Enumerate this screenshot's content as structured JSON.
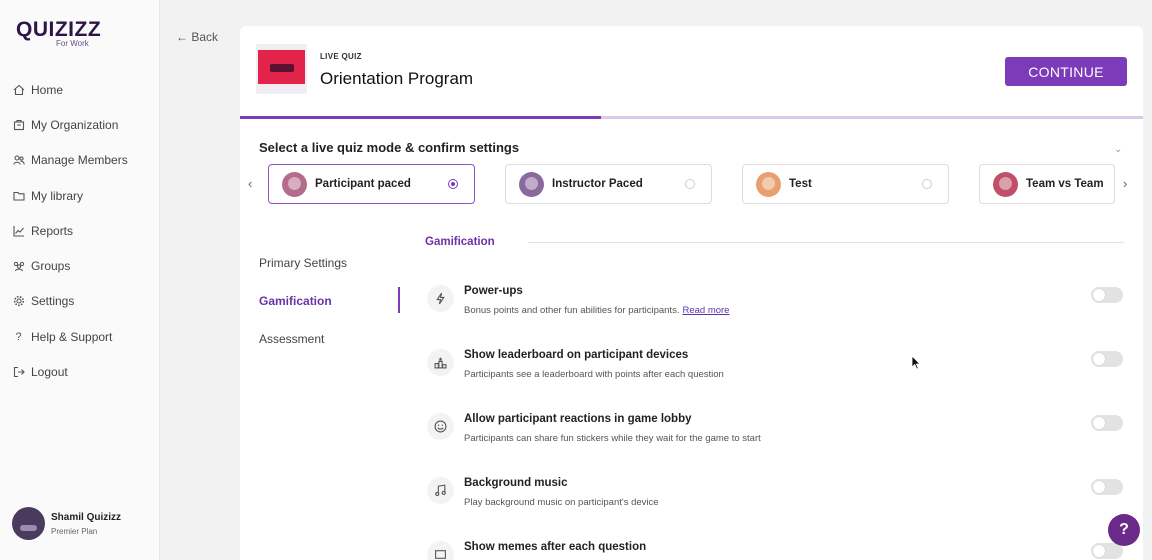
{
  "brand": {
    "logo_text": "QUIZIZZ",
    "sub_text": "For Work",
    "accent": "#7c3bb8"
  },
  "sidebar": {
    "items": [
      {
        "label": "Home",
        "icon": "home-icon"
      },
      {
        "label": "My Organization",
        "icon": "building-icon"
      },
      {
        "label": "Manage Members",
        "icon": "users-icon"
      },
      {
        "label": "My library",
        "icon": "folder-icon"
      },
      {
        "label": "Reports",
        "icon": "chart-icon"
      },
      {
        "label": "Groups",
        "icon": "group-icon"
      },
      {
        "label": "Settings",
        "icon": "gear-icon"
      },
      {
        "label": "Help & Support",
        "icon": "question-icon"
      },
      {
        "label": "Logout",
        "icon": "logout-icon"
      }
    ],
    "profile": {
      "name": "Shamil Quizizz",
      "plan": "Premier Plan"
    }
  },
  "nav": {
    "back_label": "← Back"
  },
  "quiz": {
    "type_label": "LIVE QUIZ",
    "title": "Orientation Program",
    "continue_label": "CONTINUE",
    "progress_fraction": 0.4
  },
  "modes": {
    "heading": "Select a live quiz mode & confirm settings",
    "collapse_icon": "chevron-down-icon",
    "items": [
      {
        "label": "Participant paced",
        "selected": true,
        "avatar_color": "#b56b8e"
      },
      {
        "label": "Instructor Paced",
        "selected": false,
        "avatar_color": "#8a6a9e"
      },
      {
        "label": "Test",
        "selected": false,
        "avatar_color": "#e8a070"
      },
      {
        "label": "Team vs Team",
        "selected": false,
        "avatar_color": "#c0506a"
      }
    ]
  },
  "settings_menu": {
    "items": [
      {
        "label": "Primary Settings",
        "active": false
      },
      {
        "label": "Gamification",
        "active": true
      },
      {
        "label": "Assessment",
        "active": false
      }
    ]
  },
  "gamification": {
    "section_label": "Gamification",
    "items": [
      {
        "title": "Power-ups",
        "desc": "Bonus points and other fun abilities for participants.",
        "link": "Read more",
        "icon": "lightning-icon",
        "enabled": false
      },
      {
        "title": "Show leaderboard on participant devices",
        "desc": "Participants see a leaderboard with points after each question",
        "icon": "podium-icon",
        "enabled": false
      },
      {
        "title": "Allow participant reactions in game lobby",
        "desc": "Participants can share fun stickers while they wait for the game to start",
        "icon": "smiley-icon",
        "enabled": false
      },
      {
        "title": "Background music",
        "desc": "Play background music on participant's device",
        "icon": "music-icon",
        "enabled": false
      },
      {
        "title": "Show memes after each question",
        "desc": "",
        "icon": "image-icon",
        "enabled": false
      }
    ]
  },
  "help": {
    "label": "?"
  }
}
